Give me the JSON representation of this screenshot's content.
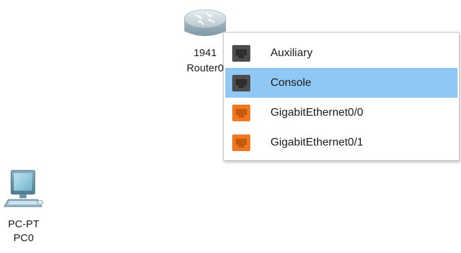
{
  "devices": {
    "router": {
      "model": "1941",
      "name": "Router0"
    },
    "pc": {
      "model": "PC-PT",
      "name": "PC0"
    }
  },
  "port_menu": {
    "items": [
      {
        "label": "Auxiliary",
        "port_type": "console-port-icon",
        "color": "#4d4d4d",
        "selected": false
      },
      {
        "label": "Console",
        "port_type": "console-port-icon",
        "color": "#4d4d4d",
        "selected": true
      },
      {
        "label": "GigabitEthernet0/0",
        "port_type": "ethernet-port-icon",
        "color": "#f07820",
        "selected": false
      },
      {
        "label": "GigabitEthernet0/1",
        "port_type": "ethernet-port-icon",
        "color": "#f07820",
        "selected": false
      }
    ],
    "highlight_color": "#90c8f5"
  }
}
